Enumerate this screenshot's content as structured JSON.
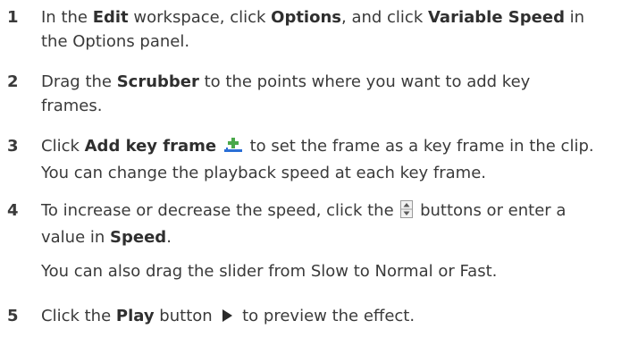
{
  "steps": [
    {
      "num": "1",
      "t1": "In the ",
      "b1": "Edit",
      "t2": " workspace, click ",
      "b2": "Options",
      "t3": ", and click ",
      "b3": "Variable Speed",
      "t4": " in",
      "line2": "the Options panel."
    },
    {
      "num": "2",
      "t1": "Drag the ",
      "b1": "Scrubber",
      "t2": " to the points where you want to add key",
      "line2": "frames."
    },
    {
      "num": "3",
      "t1": "Click ",
      "b1": "Add key frame",
      "t2": " to set the frame as a key frame in the clip.",
      "line2": "You can change the playback speed at each key frame.",
      "icon": "add-key-frame-icon"
    },
    {
      "num": "4",
      "t1": "To increase or decrease the speed, click the ",
      "t2": " buttons or enter a",
      "line2a": "value in ",
      "b1": "Speed",
      "line2b": ".",
      "icon": "spin-buttons-icon"
    },
    {
      "num": "5",
      "t1": "Click the ",
      "b1": "Play",
      "t2": " button ",
      "t3": " to preview the effect.",
      "icon": "play-icon"
    }
  ],
  "note": "You can also drag the slider from Slow to Normal or Fast.",
  "colors": {
    "text": "#3a3a3a",
    "icon_blue": "#2b6fd6",
    "icon_green": "#4aa84a"
  }
}
